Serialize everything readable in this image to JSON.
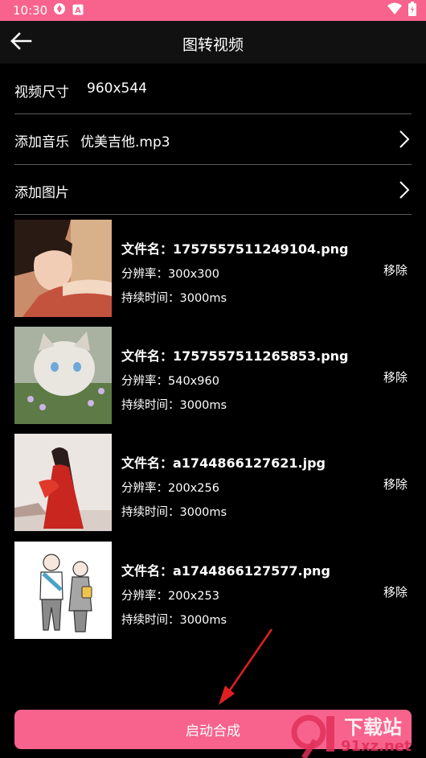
{
  "status_bar": {
    "time": "10:30",
    "icons": [
      "app-icon",
      "a-badge-icon",
      "wifi-icon",
      "battery-icon"
    ],
    "color": "#f7638d"
  },
  "app_bar": {
    "title": "图转视频",
    "back_icon": "back-arrow-icon"
  },
  "settings": {
    "video_size_label": "视频尺寸",
    "video_size_value": "960x544",
    "add_music_label": "添加音乐",
    "add_music_value": "优美吉他.mp3",
    "add_image_label": "添加图片"
  },
  "images": [
    {
      "filename": "文件名：1757557511249104.png",
      "resolution": "分辨率：300x300",
      "duration": "持续时间：3000ms",
      "remove_label": "移除"
    },
    {
      "filename": "文件名：1757557511265853.png",
      "resolution": "分辨率：540x960",
      "duration": "持续时间：3000ms",
      "remove_label": "移除"
    },
    {
      "filename": "文件名：a1744866127621.jpg",
      "resolution": "分辨率：200x256",
      "duration": "持续时间：3000ms",
      "remove_label": "移除"
    },
    {
      "filename": "文件名：a1744866127577.png",
      "resolution": "分辨率：200x253",
      "duration": "持续时间：3000ms",
      "remove_label": "移除"
    }
  ],
  "start_button_label": "启动合成",
  "watermark": {
    "brand": "下载站",
    "domain": "91xz.net"
  },
  "accent_color": "#f7638d",
  "annotation_arrow_color": "#e02020"
}
